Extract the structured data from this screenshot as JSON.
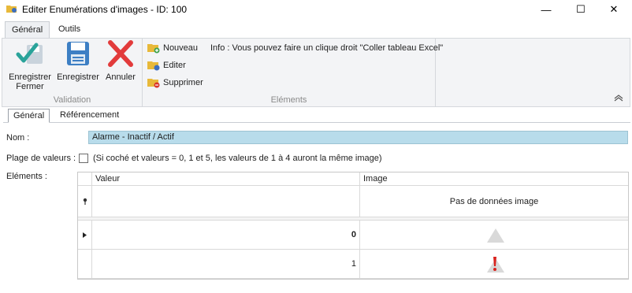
{
  "window": {
    "title": "Editer Enumérations d'images - ID: 100",
    "minimize_glyph": "—",
    "maximize_glyph": "☐",
    "close_glyph": "✕"
  },
  "ribbon": {
    "tabs": [
      {
        "label": "Général",
        "active": true
      },
      {
        "label": "Outils",
        "active": false
      }
    ],
    "groups": {
      "validation": {
        "label": "Validation",
        "save_close_label_1": "Enregistrer",
        "save_close_label_2": "Fermer",
        "save_label": "Enregistrer",
        "cancel_label": "Annuler"
      },
      "elements": {
        "label": "Eléments",
        "new_label": "Nouveau",
        "edit_label": "Editer",
        "delete_label": "Supprimer",
        "info": "Info : Vous pouvez faire un clique droit \"Coller tableau Excel\""
      }
    }
  },
  "content_tabs": [
    {
      "label": "Général",
      "active": true
    },
    {
      "label": "Référencement",
      "active": false
    }
  ],
  "form": {
    "name_label": "Nom :",
    "name_value": "Alarme - Inactif / Actif",
    "range_label": "Plage de valeurs :",
    "range_checked": false,
    "range_hint": "(Si coché et valeurs = 0, 1 et 5, les valeurs de 1 à 4 auront la même image)",
    "elements_label": "Eléments :"
  },
  "grid": {
    "columns": [
      "Valeur",
      "Image"
    ],
    "new_row_image_text": "Pas de données image",
    "rows": [
      {
        "value": "0",
        "image_icon": "warning-triangle-gray-icon",
        "selected": true
      },
      {
        "value": "1",
        "image_icon": "alarm-triangle-red-exclamation-icon",
        "selected": false
      }
    ]
  },
  "colors": {
    "name_field_bg": "#b8dceb",
    "accent_green": "#2aa39a",
    "cancel_red": "#e23b3b",
    "save_blue": "#3d7fc4"
  }
}
